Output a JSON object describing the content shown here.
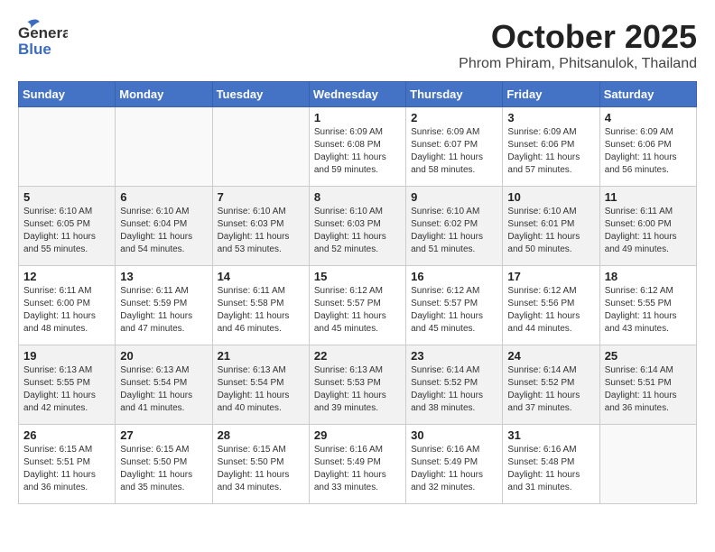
{
  "header": {
    "logo_general": "General",
    "logo_blue": "Blue",
    "month": "October 2025",
    "location": "Phrom Phiram, Phitsanulok, Thailand"
  },
  "weekdays": [
    "Sunday",
    "Monday",
    "Tuesday",
    "Wednesday",
    "Thursday",
    "Friday",
    "Saturday"
  ],
  "weeks": [
    [
      {
        "day": "",
        "info": ""
      },
      {
        "day": "",
        "info": ""
      },
      {
        "day": "",
        "info": ""
      },
      {
        "day": "1",
        "info": "Sunrise: 6:09 AM\nSunset: 6:08 PM\nDaylight: 11 hours\nand 59 minutes."
      },
      {
        "day": "2",
        "info": "Sunrise: 6:09 AM\nSunset: 6:07 PM\nDaylight: 11 hours\nand 58 minutes."
      },
      {
        "day": "3",
        "info": "Sunrise: 6:09 AM\nSunset: 6:06 PM\nDaylight: 11 hours\nand 57 minutes."
      },
      {
        "day": "4",
        "info": "Sunrise: 6:09 AM\nSunset: 6:06 PM\nDaylight: 11 hours\nand 56 minutes."
      }
    ],
    [
      {
        "day": "5",
        "info": "Sunrise: 6:10 AM\nSunset: 6:05 PM\nDaylight: 11 hours\nand 55 minutes."
      },
      {
        "day": "6",
        "info": "Sunrise: 6:10 AM\nSunset: 6:04 PM\nDaylight: 11 hours\nand 54 minutes."
      },
      {
        "day": "7",
        "info": "Sunrise: 6:10 AM\nSunset: 6:03 PM\nDaylight: 11 hours\nand 53 minutes."
      },
      {
        "day": "8",
        "info": "Sunrise: 6:10 AM\nSunset: 6:03 PM\nDaylight: 11 hours\nand 52 minutes."
      },
      {
        "day": "9",
        "info": "Sunrise: 6:10 AM\nSunset: 6:02 PM\nDaylight: 11 hours\nand 51 minutes."
      },
      {
        "day": "10",
        "info": "Sunrise: 6:10 AM\nSunset: 6:01 PM\nDaylight: 11 hours\nand 50 minutes."
      },
      {
        "day": "11",
        "info": "Sunrise: 6:11 AM\nSunset: 6:00 PM\nDaylight: 11 hours\nand 49 minutes."
      }
    ],
    [
      {
        "day": "12",
        "info": "Sunrise: 6:11 AM\nSunset: 6:00 PM\nDaylight: 11 hours\nand 48 minutes."
      },
      {
        "day": "13",
        "info": "Sunrise: 6:11 AM\nSunset: 5:59 PM\nDaylight: 11 hours\nand 47 minutes."
      },
      {
        "day": "14",
        "info": "Sunrise: 6:11 AM\nSunset: 5:58 PM\nDaylight: 11 hours\nand 46 minutes."
      },
      {
        "day": "15",
        "info": "Sunrise: 6:12 AM\nSunset: 5:57 PM\nDaylight: 11 hours\nand 45 minutes."
      },
      {
        "day": "16",
        "info": "Sunrise: 6:12 AM\nSunset: 5:57 PM\nDaylight: 11 hours\nand 45 minutes."
      },
      {
        "day": "17",
        "info": "Sunrise: 6:12 AM\nSunset: 5:56 PM\nDaylight: 11 hours\nand 44 minutes."
      },
      {
        "day": "18",
        "info": "Sunrise: 6:12 AM\nSunset: 5:55 PM\nDaylight: 11 hours\nand 43 minutes."
      }
    ],
    [
      {
        "day": "19",
        "info": "Sunrise: 6:13 AM\nSunset: 5:55 PM\nDaylight: 11 hours\nand 42 minutes."
      },
      {
        "day": "20",
        "info": "Sunrise: 6:13 AM\nSunset: 5:54 PM\nDaylight: 11 hours\nand 41 minutes."
      },
      {
        "day": "21",
        "info": "Sunrise: 6:13 AM\nSunset: 5:54 PM\nDaylight: 11 hours\nand 40 minutes."
      },
      {
        "day": "22",
        "info": "Sunrise: 6:13 AM\nSunset: 5:53 PM\nDaylight: 11 hours\nand 39 minutes."
      },
      {
        "day": "23",
        "info": "Sunrise: 6:14 AM\nSunset: 5:52 PM\nDaylight: 11 hours\nand 38 minutes."
      },
      {
        "day": "24",
        "info": "Sunrise: 6:14 AM\nSunset: 5:52 PM\nDaylight: 11 hours\nand 37 minutes."
      },
      {
        "day": "25",
        "info": "Sunrise: 6:14 AM\nSunset: 5:51 PM\nDaylight: 11 hours\nand 36 minutes."
      }
    ],
    [
      {
        "day": "26",
        "info": "Sunrise: 6:15 AM\nSunset: 5:51 PM\nDaylight: 11 hours\nand 36 minutes."
      },
      {
        "day": "27",
        "info": "Sunrise: 6:15 AM\nSunset: 5:50 PM\nDaylight: 11 hours\nand 35 minutes."
      },
      {
        "day": "28",
        "info": "Sunrise: 6:15 AM\nSunset: 5:50 PM\nDaylight: 11 hours\nand 34 minutes."
      },
      {
        "day": "29",
        "info": "Sunrise: 6:16 AM\nSunset: 5:49 PM\nDaylight: 11 hours\nand 33 minutes."
      },
      {
        "day": "30",
        "info": "Sunrise: 6:16 AM\nSunset: 5:49 PM\nDaylight: 11 hours\nand 32 minutes."
      },
      {
        "day": "31",
        "info": "Sunrise: 6:16 AM\nSunset: 5:48 PM\nDaylight: 11 hours\nand 31 minutes."
      },
      {
        "day": "",
        "info": ""
      }
    ]
  ]
}
